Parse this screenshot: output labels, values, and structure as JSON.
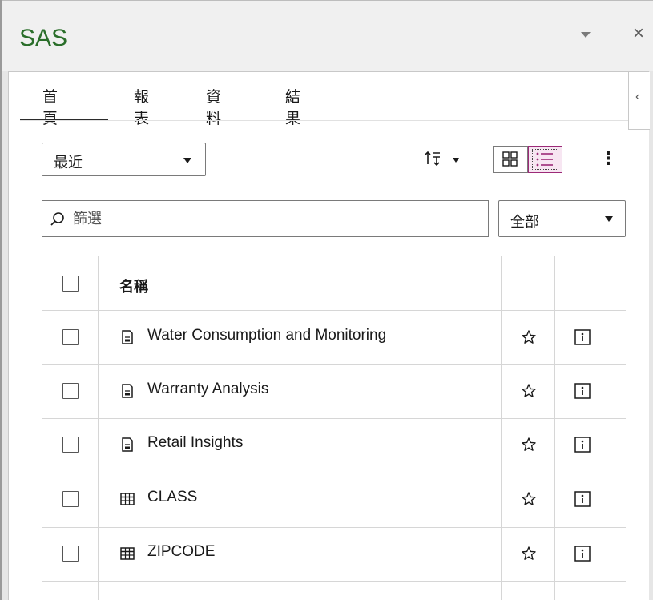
{
  "titlebar": {
    "title": "SAS",
    "close_label": "×"
  },
  "tabs": [
    {
      "label": "首頁",
      "selected": true
    },
    {
      "label": "報表",
      "selected": false
    },
    {
      "label": "資料",
      "selected": false
    },
    {
      "label": "結果",
      "selected": false
    }
  ],
  "toolbar": {
    "recent_select_value": "最近",
    "more_label": "⋮"
  },
  "filter": {
    "placeholder": "篩選",
    "type_select_value": "全部"
  },
  "table": {
    "header": {
      "name": "名稱"
    },
    "rows": [
      {
        "label": "Water Consumption and Monitoring",
        "type_icon": "report-icon"
      },
      {
        "label": "Warranty Analysis",
        "type_icon": "report-icon"
      },
      {
        "label": "Retail Insights",
        "type_icon": "report-icon"
      },
      {
        "label": "CLASS",
        "type_icon": "table-icon"
      },
      {
        "label": "ZIPCODE",
        "type_icon": "table-icon"
      }
    ]
  },
  "colors": {
    "title_green": "#2a6e2a",
    "selected_view_border": "#9c2a78",
    "selected_view_bg": "#f7e6f2"
  }
}
